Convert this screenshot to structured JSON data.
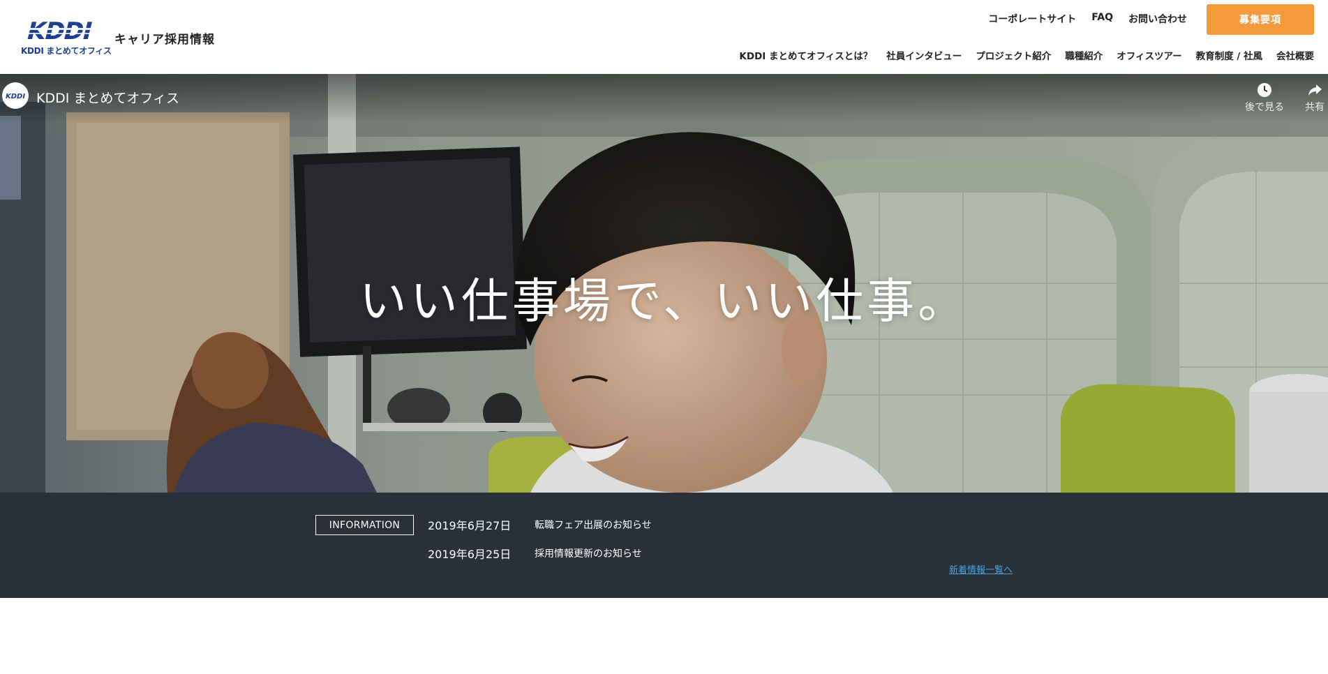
{
  "header": {
    "logo_text": "KDDI",
    "logo_subtext": "KDDI まとめてオフィス",
    "site_title": "キャリア採用情報",
    "util_nav": [
      "コーポレートサイト",
      "FAQ",
      "お問い合わせ"
    ],
    "cta_label": "募集要項",
    "main_nav": [
      "KDDI まとめてオフィスとは？",
      "社員インタビュー",
      "プロジェクト紹介",
      "職種紹介",
      "オフィスツアー",
      "教育制度 / 社風",
      "会社概要"
    ]
  },
  "video": {
    "channel_name": "KDDI まとめてオフィス",
    "watch_later_label": "後で見る",
    "share_label": "共有"
  },
  "hero": {
    "headline": "いい仕事場で、いい仕事。"
  },
  "information": {
    "badge": "INFORMATION",
    "items": [
      {
        "date": "2019年6月27日",
        "title": "転職フェア出展のお知らせ"
      },
      {
        "date": "2019年6月25日",
        "title": "採用情報更新のお知らせ"
      }
    ],
    "more_link": "新着情報一覧へ"
  },
  "colors": {
    "accent_orange": "#f29a3c",
    "logo_blue": "#1d3f8f",
    "info_bg": "#293038",
    "link_blue": "#4aa3df"
  }
}
